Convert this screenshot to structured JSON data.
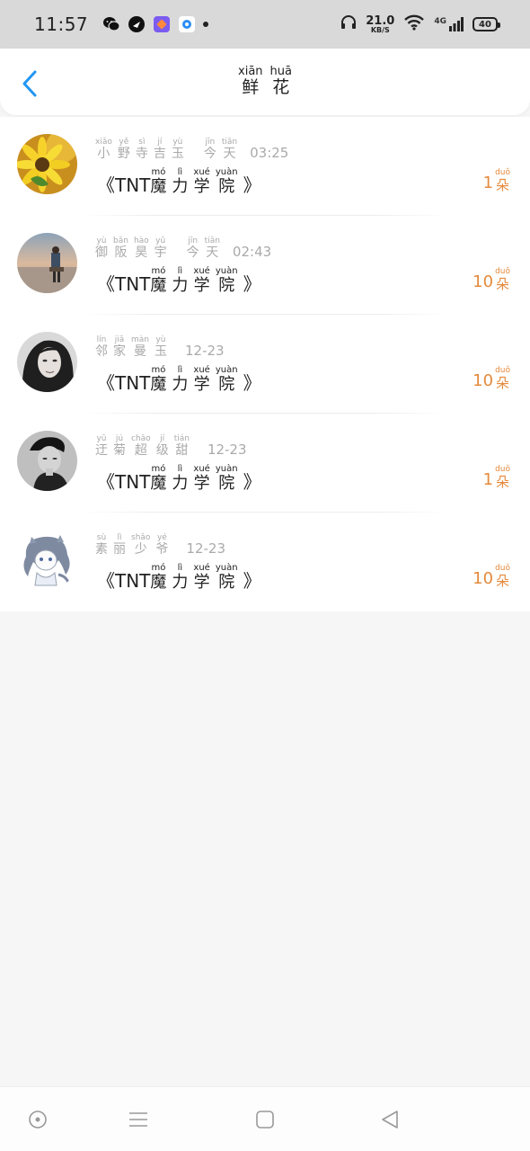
{
  "status_bar": {
    "time": "11:57",
    "net_speed": "21.0",
    "net_unit": "KB/S",
    "network": "4G",
    "battery": "40",
    "icons": [
      "wechat-icon",
      "app-icon",
      "office-icon",
      "app-icon-blue",
      "notification-dot-icon",
      "headphone-icon",
      "wifi-icon",
      "signal-icon",
      "battery-icon"
    ]
  },
  "header": {
    "title": [
      {
        "py": "xiān",
        "hz": "鲜"
      },
      {
        "py": "huā",
        "hz": "花"
      }
    ]
  },
  "gift_records": [
    {
      "sender": [
        {
          "py": "xiǎo",
          "hz": "小"
        },
        {
          "py": "yě",
          "hz": "野"
        },
        {
          "py": "sì",
          "hz": "寺"
        },
        {
          "py": "jí",
          "hz": "吉"
        },
        {
          "py": "yù",
          "hz": "玉"
        }
      ],
      "day": [
        {
          "py": "jīn",
          "hz": "今"
        },
        {
          "py": "tiān",
          "hz": "天"
        }
      ],
      "time": "03:25",
      "gift_prefix": "《TNT",
      "gift": [
        {
          "py": "mó",
          "hz": "魔"
        },
        {
          "py": "lì",
          "hz": "力"
        },
        {
          "py": "xué",
          "hz": "学"
        },
        {
          "py": "yuàn",
          "hz": "院"
        }
      ],
      "gift_suffix": "》",
      "count": "1",
      "unit": {
        "py": "duǒ",
        "hz": "朵"
      }
    },
    {
      "sender": [
        {
          "py": "yù",
          "hz": "御"
        },
        {
          "py": "bǎn",
          "hz": "阪"
        },
        {
          "py": "hào",
          "hz": "昊"
        },
        {
          "py": "yǔ",
          "hz": "宇"
        }
      ],
      "day": [
        {
          "py": "jīn",
          "hz": "今"
        },
        {
          "py": "tiān",
          "hz": "天"
        }
      ],
      "time": "02:43",
      "gift_prefix": "《TNT",
      "gift": [
        {
          "py": "mó",
          "hz": "魔"
        },
        {
          "py": "lì",
          "hz": "力"
        },
        {
          "py": "xué",
          "hz": "学"
        },
        {
          "py": "yuàn",
          "hz": "院"
        }
      ],
      "gift_suffix": "》",
      "count": "10",
      "unit": {
        "py": "duǒ",
        "hz": "朵"
      }
    },
    {
      "sender": [
        {
          "py": "lín",
          "hz": "邻"
        },
        {
          "py": "jiā",
          "hz": "家"
        },
        {
          "py": "màn",
          "hz": "曼"
        },
        {
          "py": "yù",
          "hz": "玉"
        }
      ],
      "day": [],
      "time": "12-23",
      "gift_prefix": "《TNT",
      "gift": [
        {
          "py": "mó",
          "hz": "魔"
        },
        {
          "py": "lì",
          "hz": "力"
        },
        {
          "py": "xué",
          "hz": "学"
        },
        {
          "py": "yuàn",
          "hz": "院"
        }
      ],
      "gift_suffix": "》",
      "count": "10",
      "unit": {
        "py": "duǒ",
        "hz": "朵"
      }
    },
    {
      "sender": [
        {
          "py": "yū",
          "hz": "迂"
        },
        {
          "py": "jú",
          "hz": "菊"
        },
        {
          "py": "chāo",
          "hz": "超"
        },
        {
          "py": "jí",
          "hz": "级"
        },
        {
          "py": "tián",
          "hz": "甜"
        }
      ],
      "day": [],
      "time": "12-23",
      "gift_prefix": "《TNT",
      "gift": [
        {
          "py": "mó",
          "hz": "魔"
        },
        {
          "py": "lì",
          "hz": "力"
        },
        {
          "py": "xué",
          "hz": "学"
        },
        {
          "py": "yuàn",
          "hz": "院"
        }
      ],
      "gift_suffix": "》",
      "count": "1",
      "unit": {
        "py": "duǒ",
        "hz": "朵"
      }
    },
    {
      "sender": [
        {
          "py": "sù",
          "hz": "素"
        },
        {
          "py": "lì",
          "hz": "丽"
        },
        {
          "py": "shǎo",
          "hz": "少"
        },
        {
          "py": "yé",
          "hz": "爷"
        }
      ],
      "day": [],
      "time": "12-23",
      "gift_prefix": "《TNT",
      "gift": [
        {
          "py": "mó",
          "hz": "魔"
        },
        {
          "py": "lì",
          "hz": "力"
        },
        {
          "py": "xué",
          "hz": "学"
        },
        {
          "py": "yuàn",
          "hz": "院"
        }
      ],
      "gift_suffix": "》",
      "count": "10",
      "unit": {
        "py": "duǒ",
        "hz": "朵"
      }
    }
  ],
  "avatars": [
    "flower-avatar",
    "beach-avatar",
    "woman-avatar",
    "man-avatar",
    "anime-avatar"
  ],
  "nav_bar": {
    "buttons": [
      "assistant-circle-icon",
      "menu-icon",
      "home-square-icon",
      "back-triangle-icon"
    ]
  },
  "colors": {
    "accent": "#e58a3c",
    "back": "#2196f3",
    "muted": "#aaaaaa"
  }
}
